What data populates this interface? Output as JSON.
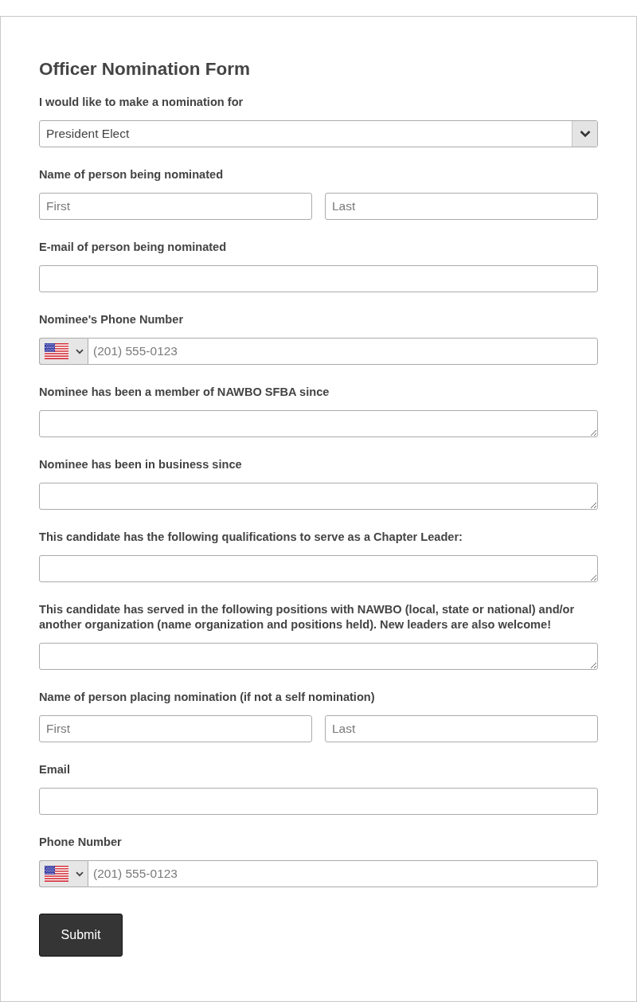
{
  "form": {
    "title": "Officer Nomination Form",
    "fields": [
      {
        "kind": "select",
        "label": "I would like to make a nomination for",
        "value": "President Elect"
      },
      {
        "kind": "name",
        "label": "Name of person being nominated",
        "first_placeholder": "First",
        "last_placeholder": "Last"
      },
      {
        "kind": "input",
        "label": "E-mail of person being nominated"
      },
      {
        "kind": "phone",
        "label": "Nominee's Phone Number",
        "placeholder": "(201) 555-0123"
      },
      {
        "kind": "textarea",
        "label": "Nominee has been a member of NAWBO SFBA since"
      },
      {
        "kind": "textarea",
        "label": "Nominee has been in business since"
      },
      {
        "kind": "textarea",
        "label": "This candidate has the following qualifications to serve as a Chapter Leader:"
      },
      {
        "kind": "textarea",
        "label": "This candidate has served in the following positions with NAWBO (local, state or national) and/or another organization (name organization and positions held). New leaders are also welcome!"
      },
      {
        "kind": "name",
        "label": "Name of person placing nomination (if not a self nomination)",
        "first_placeholder": "First",
        "last_placeholder": "Last"
      },
      {
        "kind": "input",
        "label": "Email"
      },
      {
        "kind": "phone",
        "label": "Phone Number",
        "placeholder": "(201) 555-0123"
      }
    ],
    "submit_button": "Submit"
  }
}
